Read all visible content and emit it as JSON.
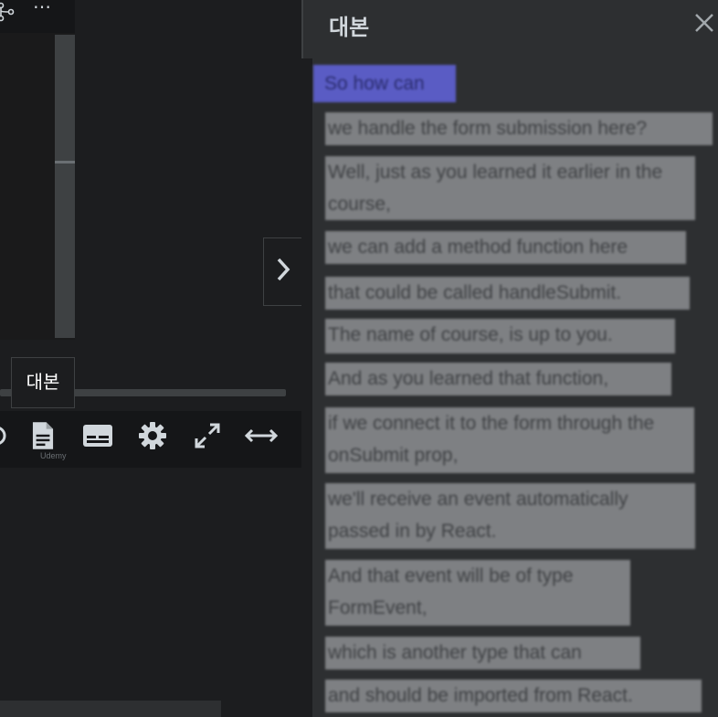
{
  "top_bar": {
    "fork_icon": "git-fork-icon",
    "more_icon": "⋯"
  },
  "tooltip": {
    "text": "대본"
  },
  "controls": {
    "transcript_icon": "transcript-icon",
    "captions_icon": "captions-icon",
    "settings_icon": "gear-icon",
    "fullscreen_icon": "fullscreen-icon",
    "expand_icon": "expand-horizontal-icon",
    "brand": "Udemy"
  },
  "next_button": {
    "icon": "chevron-right-icon"
  },
  "transcript": {
    "title": "대본",
    "close_icon": "close-icon",
    "cues": [
      {
        "text": "So how can"
      },
      {
        "text": "we handle the form submission here?"
      },
      {
        "text": "Well, just as you learned it earlier in the course,"
      },
      {
        "text": "we can add a method function here"
      },
      {
        "text": "that could be called handleSubmit."
      },
      {
        "text": "The name of course, is up to you."
      },
      {
        "text": "And as you learned that function,"
      },
      {
        "text": "if we connect it to the form through the onSubmit prop,"
      },
      {
        "text": "we'll receive an event automatically passed in by React."
      },
      {
        "text": "And that event will be of type FormEvent,"
      },
      {
        "text": "which is another type that can"
      },
      {
        "text": "and should be imported from React."
      }
    ]
  },
  "colors": {
    "panel_bg": "#2d2f31",
    "player_bg": "#1c1d1f",
    "active_cue": "#5a5cc4",
    "cue_bg": "#7e8083"
  }
}
